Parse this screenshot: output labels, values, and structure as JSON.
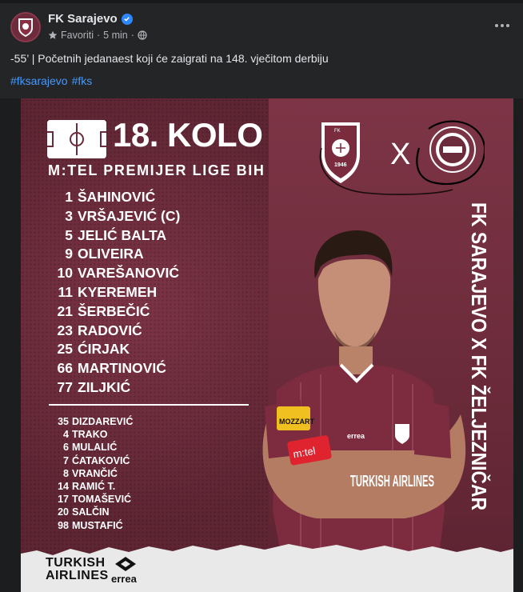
{
  "post": {
    "page_name": "FK Sarajevo",
    "meta_label": "Favoriti",
    "separator": "·",
    "time": "5 min",
    "separator2": "·",
    "text": "-55’ | Početnih jedanaest koji će zaigrati na 148. vječitom derbiju",
    "hashtags": [
      "#fksarajevo",
      "#fks"
    ]
  },
  "graphic": {
    "round": "18. KOLO",
    "league": "M:TEL PREMIJER LIGE BIH",
    "match_vertical": "FK SARAJEVO X FK ŽELJEZNIČAR",
    "versus": "X",
    "home_badge_year": "1946",
    "home_badge_initials": "FK",
    "shirt_sponsor": "TURKISH AIRLINES",
    "shirt_badge": "MOZZART",
    "sleeve_text": "m:tel",
    "kit_brand": "errea",
    "starters": [
      {
        "num": "1",
        "name": "ŠAHINOVIĆ"
      },
      {
        "num": "3",
        "name": "VRŠAJEVIĆ (C)"
      },
      {
        "num": "5",
        "name": "JELIĆ BALTA"
      },
      {
        "num": "9",
        "name": "OLIVEIRA"
      },
      {
        "num": "10",
        "name": "VAREŠANOVIĆ"
      },
      {
        "num": "11",
        "name": "KYEREMEH"
      },
      {
        "num": "21",
        "name": "ŠERBEČIĆ"
      },
      {
        "num": "23",
        "name": "RADOVIĆ"
      },
      {
        "num": "25",
        "name": "ĆIRJAK"
      },
      {
        "num": "66",
        "name": "MARTINOVIĆ"
      },
      {
        "num": "77",
        "name": "ZILJKIĆ"
      }
    ],
    "subs": [
      {
        "num": "35",
        "name": "DIZDAREVIĆ"
      },
      {
        "num": "4",
        "name": "TRAKO"
      },
      {
        "num": "6",
        "name": "MULALIĆ"
      },
      {
        "num": "7",
        "name": "ĆATAKOVIĆ"
      },
      {
        "num": "8",
        "name": "VRANČIĆ"
      },
      {
        "num": "14",
        "name": "RAMIĆ T."
      },
      {
        "num": "17",
        "name": "TOMAŠEVIĆ"
      },
      {
        "num": "20",
        "name": "SALČIN"
      },
      {
        "num": "98",
        "name": "MUSTAFIĆ"
      }
    ],
    "sponsor_line1": "TURKISH",
    "sponsor_line2": "AIRLINES",
    "sponsor_brand": "errea"
  },
  "colors": {
    "maroon": "#6b2b3a",
    "link": "#4599ff",
    "verified": "#2d88ff"
  }
}
